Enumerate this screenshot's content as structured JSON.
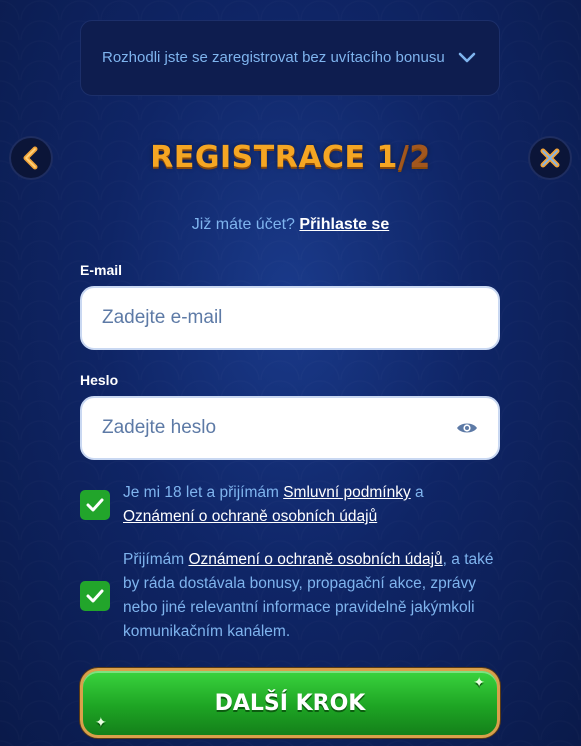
{
  "bonus_bar": {
    "text": "Rozhodli jste se zaregistrovat bez uvítacího bonusu",
    "icon": "chevron-down-icon"
  },
  "header": {
    "title_main": "REGISTRACE 1",
    "title_sep": "/",
    "title_total": "2",
    "back_icon": "back-arrow-icon",
    "close_icon": "close-icon"
  },
  "login_prompt": {
    "text": "Již máte účet?",
    "link": "Přihlaste se"
  },
  "form": {
    "email": {
      "label": "E-mail",
      "placeholder": "Zadejte e-mail",
      "value": ""
    },
    "password": {
      "label": "Heslo",
      "placeholder": "Zadejte heslo",
      "value": "",
      "icon": "eye-icon"
    }
  },
  "consents": [
    {
      "checked": true,
      "text_before": "Je mi 18 let a přijímám ",
      "link1": "Smluvní podmínky",
      "text_mid": " a",
      "link2": "Oznámení o ochraně osobních údajů"
    },
    {
      "checked": true,
      "text_before": "Přijímám ",
      "link1": "Oznámení o ochraně osobních údajů",
      "text_after": ", a také by ráda dostávala bonusy, propagační akce, zprávy nebo jiné relevantní informace pravidelně jakýmkoli komunikačním kanálem."
    }
  ],
  "cta": {
    "label": "DALŠÍ KROK"
  },
  "colors": {
    "accent_text": "#7fb4ee",
    "title_orange": "#f5a623",
    "checkbox_green": "#22a52b",
    "button_green": "#1ea524"
  }
}
